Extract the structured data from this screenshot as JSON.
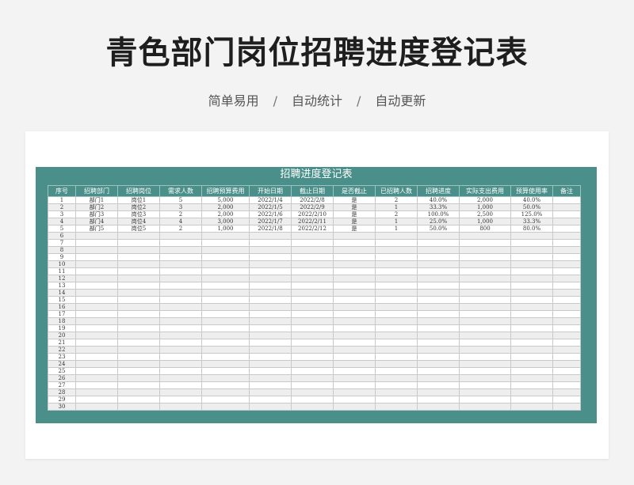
{
  "header": {
    "title": "青色部门岗位招聘进度登记表",
    "tags": [
      "简单易用",
      "自动统计",
      "自动更新"
    ],
    "separator": "/"
  },
  "sheet": {
    "title": "招聘进度登记表",
    "columns": [
      "序号",
      "招聘部门",
      "招聘岗位",
      "需求人数",
      "招聘预算费用",
      "开始日期",
      "截止日期",
      "是否截止",
      "已招聘人数",
      "招聘进度",
      "实际支出费用",
      "预算使用率",
      "备注"
    ],
    "rows": [
      [
        "1",
        "部门1",
        "岗位1",
        "5",
        "5,000",
        "2022/1/4",
        "2022/2/8",
        "是",
        "2",
        "40.0%",
        "2,000",
        "40.0%",
        ""
      ],
      [
        "2",
        "部门2",
        "岗位2",
        "3",
        "2,000",
        "2022/1/5",
        "2022/2/9",
        "是",
        "1",
        "33.3%",
        "1,000",
        "50.0%",
        ""
      ],
      [
        "3",
        "部门3",
        "岗位3",
        "2",
        "2,000",
        "2022/1/6",
        "2022/2/10",
        "是",
        "2",
        "100.0%",
        "2,500",
        "125.0%",
        ""
      ],
      [
        "4",
        "部门4",
        "岗位4",
        "4",
        "3,000",
        "2022/1/7",
        "2022/2/11",
        "是",
        "1",
        "25.0%",
        "1,000",
        "33.3%",
        ""
      ],
      [
        "5",
        "部门5",
        "岗位5",
        "2",
        "1,000",
        "2022/1/8",
        "2022/2/12",
        "是",
        "1",
        "50.0%",
        "800",
        "80.0%",
        ""
      ],
      [
        "6",
        "",
        "",
        "",
        "",
        "",
        "",
        "",
        "",
        "",
        "",
        "",
        ""
      ],
      [
        "7",
        "",
        "",
        "",
        "",
        "",
        "",
        "",
        "",
        "",
        "",
        "",
        ""
      ],
      [
        "8",
        "",
        "",
        "",
        "",
        "",
        "",
        "",
        "",
        "",
        "",
        "",
        ""
      ],
      [
        "9",
        "",
        "",
        "",
        "",
        "",
        "",
        "",
        "",
        "",
        "",
        "",
        ""
      ],
      [
        "10",
        "",
        "",
        "",
        "",
        "",
        "",
        "",
        "",
        "",
        "",
        "",
        ""
      ],
      [
        "11",
        "",
        "",
        "",
        "",
        "",
        "",
        "",
        "",
        "",
        "",
        "",
        ""
      ],
      [
        "12",
        "",
        "",
        "",
        "",
        "",
        "",
        "",
        "",
        "",
        "",
        "",
        ""
      ],
      [
        "13",
        "",
        "",
        "",
        "",
        "",
        "",
        "",
        "",
        "",
        "",
        "",
        ""
      ],
      [
        "14",
        "",
        "",
        "",
        "",
        "",
        "",
        "",
        "",
        "",
        "",
        "",
        ""
      ],
      [
        "15",
        "",
        "",
        "",
        "",
        "",
        "",
        "",
        "",
        "",
        "",
        "",
        ""
      ],
      [
        "16",
        "",
        "",
        "",
        "",
        "",
        "",
        "",
        "",
        "",
        "",
        "",
        ""
      ],
      [
        "17",
        "",
        "",
        "",
        "",
        "",
        "",
        "",
        "",
        "",
        "",
        "",
        ""
      ],
      [
        "18",
        "",
        "",
        "",
        "",
        "",
        "",
        "",
        "",
        "",
        "",
        "",
        ""
      ],
      [
        "19",
        "",
        "",
        "",
        "",
        "",
        "",
        "",
        "",
        "",
        "",
        "",
        ""
      ],
      [
        "20",
        "",
        "",
        "",
        "",
        "",
        "",
        "",
        "",
        "",
        "",
        "",
        ""
      ],
      [
        "21",
        "",
        "",
        "",
        "",
        "",
        "",
        "",
        "",
        "",
        "",
        "",
        ""
      ],
      [
        "22",
        "",
        "",
        "",
        "",
        "",
        "",
        "",
        "",
        "",
        "",
        "",
        ""
      ],
      [
        "23",
        "",
        "",
        "",
        "",
        "",
        "",
        "",
        "",
        "",
        "",
        "",
        ""
      ],
      [
        "24",
        "",
        "",
        "",
        "",
        "",
        "",
        "",
        "",
        "",
        "",
        "",
        ""
      ],
      [
        "25",
        "",
        "",
        "",
        "",
        "",
        "",
        "",
        "",
        "",
        "",
        "",
        ""
      ],
      [
        "26",
        "",
        "",
        "",
        "",
        "",
        "",
        "",
        "",
        "",
        "",
        "",
        ""
      ],
      [
        "27",
        "",
        "",
        "",
        "",
        "",
        "",
        "",
        "",
        "",
        "",
        "",
        ""
      ],
      [
        "28",
        "",
        "",
        "",
        "",
        "",
        "",
        "",
        "",
        "",
        "",
        "",
        ""
      ],
      [
        "29",
        "",
        "",
        "",
        "",
        "",
        "",
        "",
        "",
        "",
        "",
        "",
        ""
      ],
      [
        "30",
        "",
        "",
        "",
        "",
        "",
        "",
        "",
        "",
        "",
        "",
        "",
        ""
      ]
    ]
  }
}
